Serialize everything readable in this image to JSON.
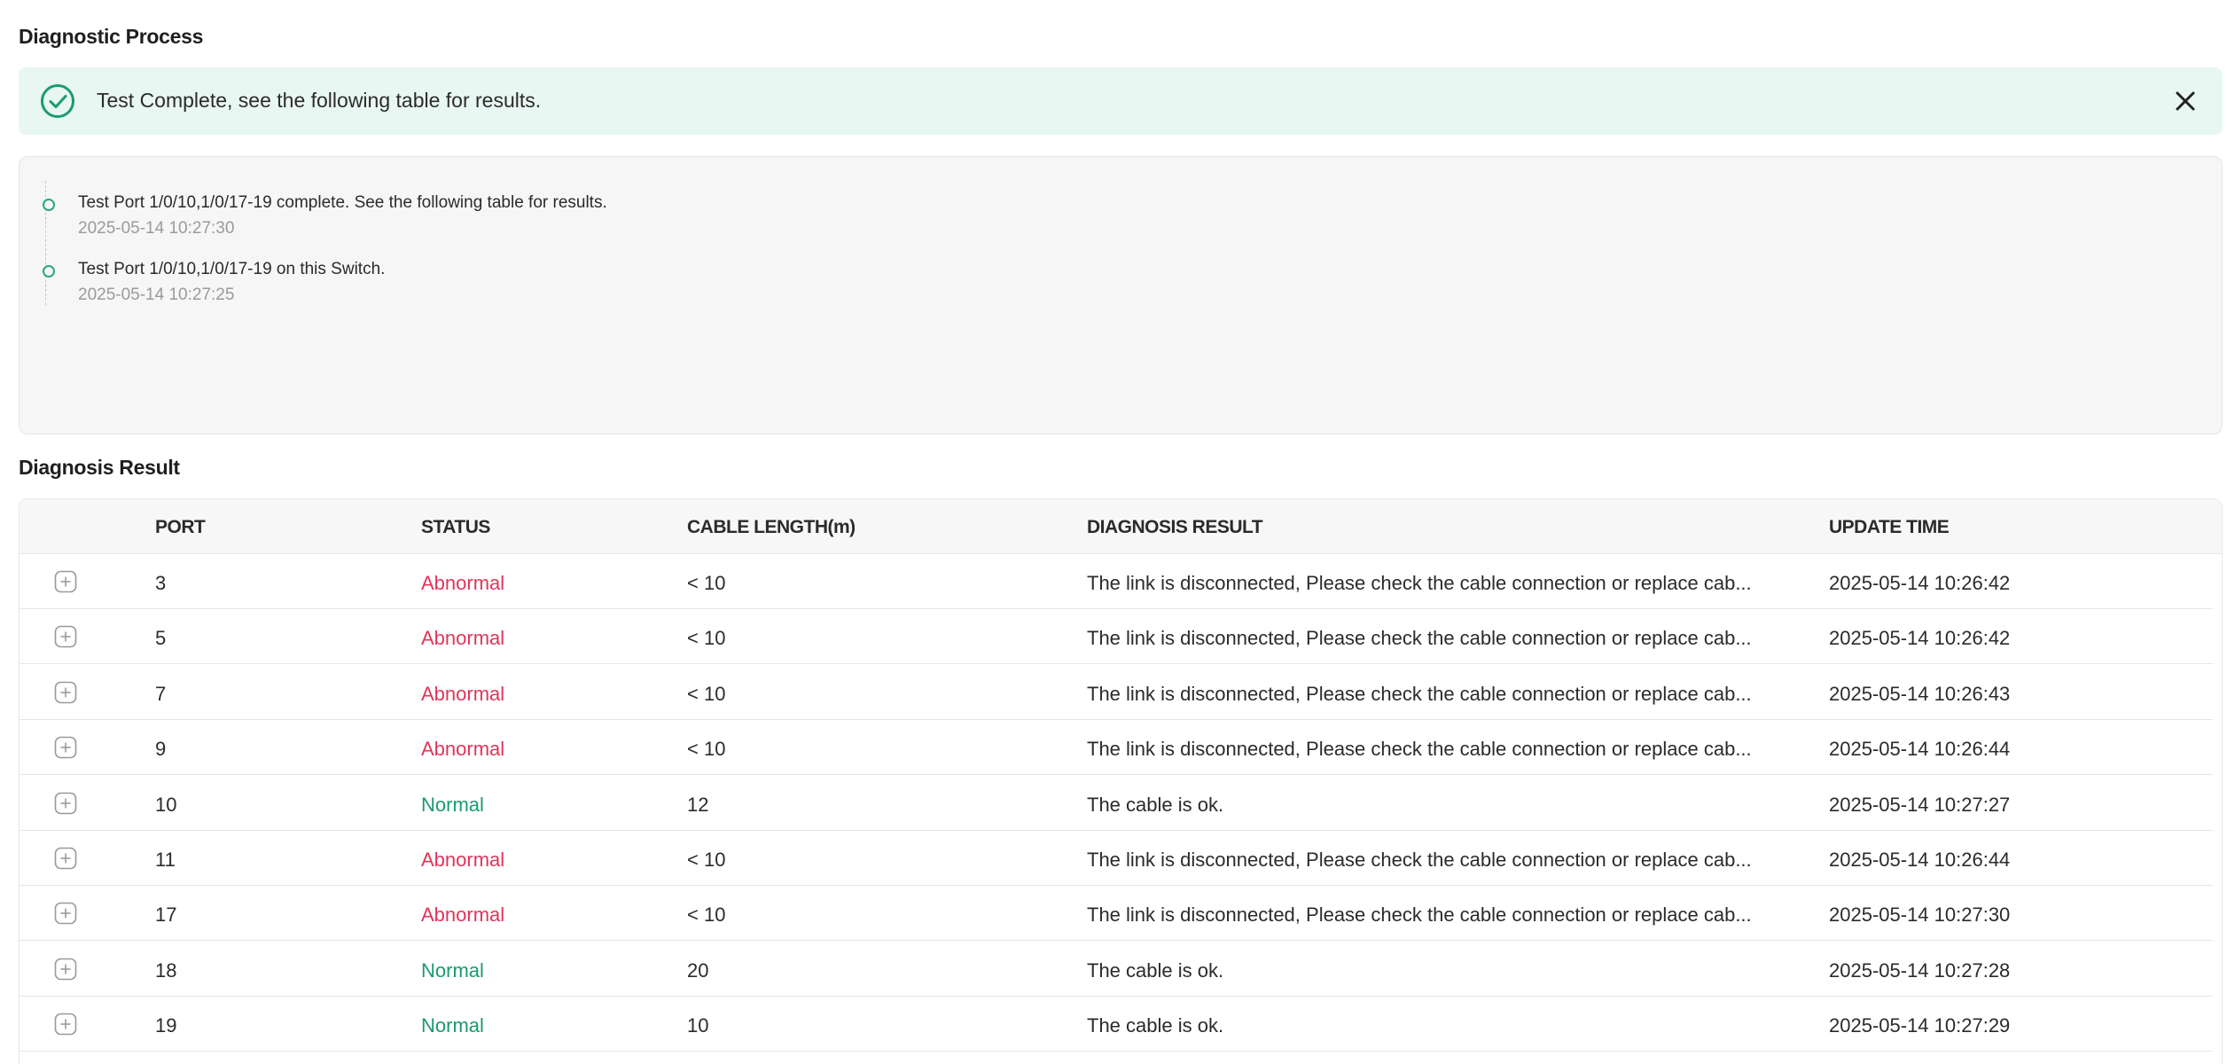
{
  "process": {
    "title": "Diagnostic Process",
    "banner_text": "Test Complete, see the following table for results.",
    "log": [
      {
        "message": "Test Port 1/0/10,1/0/17-19 complete. See the following table for results.",
        "time": "2025-05-14 10:27:30"
      },
      {
        "message": "Test Port 1/0/10,1/0/17-19 on this Switch.",
        "time": "2025-05-14 10:27:25"
      }
    ]
  },
  "result": {
    "title": "Diagnosis Result",
    "columns": {
      "port": "PORT",
      "status": "STATUS",
      "cable_length": "CABLE LENGTH(m)",
      "diagnosis": "DIAGNOSIS RESULT",
      "update_time": "UPDATE TIME"
    },
    "rows": [
      {
        "port": "3",
        "status": "Abnormal",
        "length": "< 10",
        "diagnosis": "The link is disconnected, Please check the cable connection or replace cab...",
        "time": "2025-05-14 10:26:42"
      },
      {
        "port": "5",
        "status": "Abnormal",
        "length": "< 10",
        "diagnosis": "The link is disconnected, Please check the cable connection or replace cab...",
        "time": "2025-05-14 10:26:42"
      },
      {
        "port": "7",
        "status": "Abnormal",
        "length": "< 10",
        "diagnosis": "The link is disconnected, Please check the cable connection or replace cab...",
        "time": "2025-05-14 10:26:43"
      },
      {
        "port": "9",
        "status": "Abnormal",
        "length": "< 10",
        "diagnosis": "The link is disconnected, Please check the cable connection or replace cab...",
        "time": "2025-05-14 10:26:44"
      },
      {
        "port": "10",
        "status": "Normal",
        "length": "12",
        "diagnosis": "The cable is ok.",
        "time": "2025-05-14 10:27:27"
      },
      {
        "port": "11",
        "status": "Abnormal",
        "length": "< 10",
        "diagnosis": "The link is disconnected, Please check the cable connection or replace cab...",
        "time": "2025-05-14 10:26:44"
      },
      {
        "port": "17",
        "status": "Abnormal",
        "length": "< 10",
        "diagnosis": "The link is disconnected, Please check the cable connection or replace cab...",
        "time": "2025-05-14 10:27:30"
      },
      {
        "port": "18",
        "status": "Normal",
        "length": "20",
        "diagnosis": "The cable is ok.",
        "time": "2025-05-14 10:27:28"
      },
      {
        "port": "19",
        "status": "Normal",
        "length": "10",
        "diagnosis": "The cable is ok.",
        "time": "2025-05-14 10:27:29"
      }
    ]
  },
  "colors": {
    "success_green": "#1a9b6c",
    "banner_bg": "#e8f7f1",
    "abnormal_red": "#e0355a"
  },
  "icons": {
    "banner": "check-circle-icon",
    "close": "close-icon",
    "expand": "plus-square-icon"
  }
}
